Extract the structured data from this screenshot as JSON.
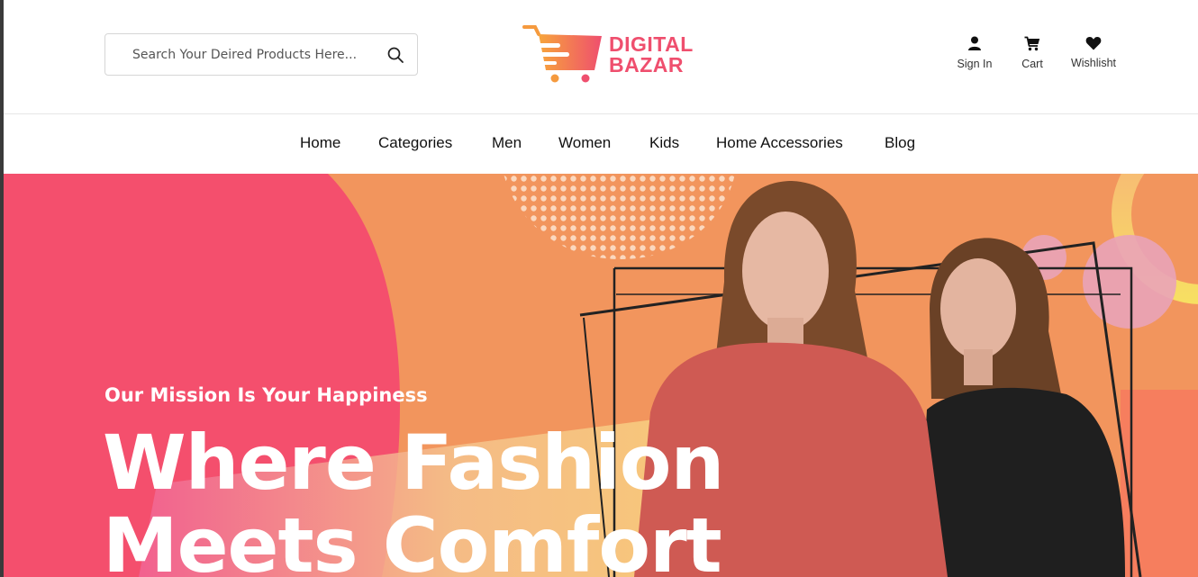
{
  "header": {
    "search": {
      "placeholder": "Search Your Deired Products Here...",
      "value": ""
    },
    "logo": {
      "line1": "DIGITAL",
      "line2": "BAZAR"
    },
    "actions": [
      {
        "label": "Sign In",
        "icon": "user-icon"
      },
      {
        "label": "Cart",
        "icon": "cart-icon"
      },
      {
        "label": "Wishlisht",
        "icon": "heart-icon"
      }
    ]
  },
  "nav": {
    "items": [
      {
        "label": "Home"
      },
      {
        "label": "Categories"
      },
      {
        "label": "Men"
      },
      {
        "label": "Women"
      },
      {
        "label": "Kids"
      },
      {
        "label": "Home Accessories"
      },
      {
        "label": "Blog"
      }
    ]
  },
  "hero": {
    "tagline": "Our Mission Is Your Happiness",
    "headline_line1": "Where Fashion",
    "headline_line2": "Meets Comfort"
  },
  "colors": {
    "brand_pink": "#ef4f6e",
    "brand_orange": "#f59a3e",
    "hero_orange": "#f2955d",
    "hero_pink": "#f44f6d"
  }
}
